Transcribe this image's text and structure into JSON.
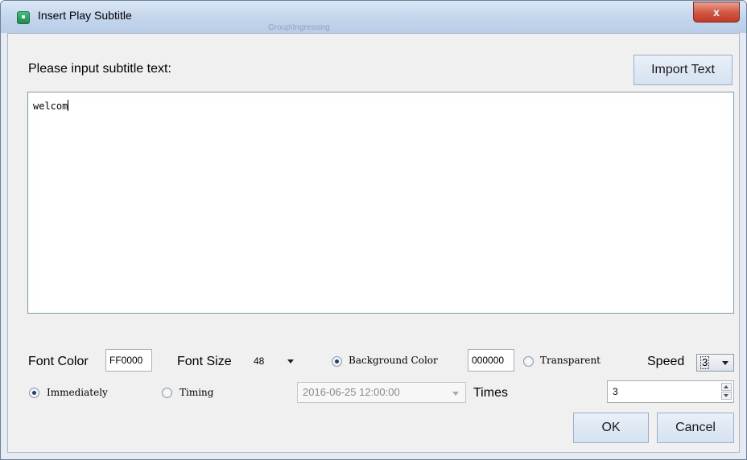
{
  "window": {
    "title": "Insert Play Subtitle",
    "background_title": "Group\\Ingressing",
    "close_glyph": "x"
  },
  "prompt": {
    "label": "Please input subtitle text:",
    "import_button": "Import Text"
  },
  "subtitle_text": "welcom",
  "style": {
    "font_color_label": "Font Color",
    "font_color_value": "FF0000",
    "font_size_label": "Font Size",
    "font_size_value": "48",
    "background_color_label": "Background Color",
    "background_color_value": "000000",
    "background_color_selected": true,
    "transparent_label": "Transparent",
    "speed_label": "Speed",
    "speed_value": "3"
  },
  "timing": {
    "immediately_label": "Immediately",
    "immediately_selected": true,
    "timing_label": "Timing",
    "datetime_value": "2016-06-25 12:00:00",
    "times_label": "Times",
    "times_value": "3"
  },
  "buttons": {
    "ok": "OK",
    "cancel": "Cancel"
  },
  "colors": {
    "titlebar": "#c3d5ec",
    "close": "#c23a25",
    "dialog_bg": "#f0f0f0"
  },
  "icons": [
    "app-icon",
    "close-icon",
    "chevron-down-icon",
    "spin-up-icon",
    "spin-down-icon"
  ]
}
